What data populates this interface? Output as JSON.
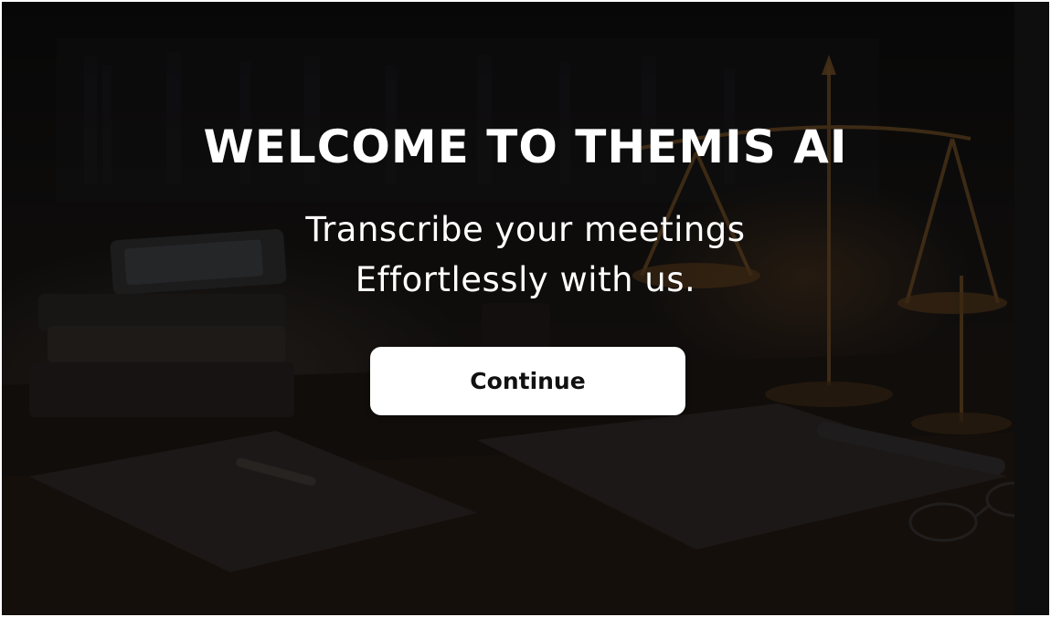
{
  "welcome": {
    "title": "WELCOME TO THEMIS AI",
    "subtitle_line1": "Transcribe your meetings",
    "subtitle_line2": "Effortlessly with us.",
    "continue_label": "Continue"
  },
  "colors": {
    "text": "#ffffff",
    "button_bg": "#ffffff",
    "button_text": "#111111",
    "background": "#0b0908"
  }
}
